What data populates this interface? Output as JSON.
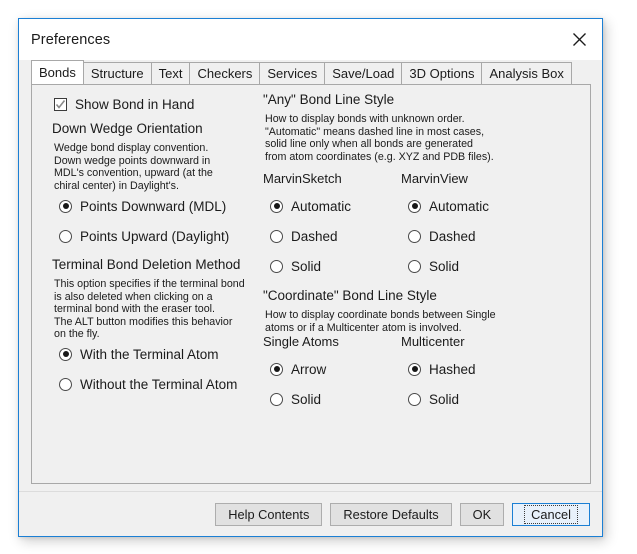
{
  "window": {
    "title": "Preferences",
    "close_icon": "close-icon",
    "accent_color": "#1b7fd4",
    "bg_color": "#f0f0f0"
  },
  "tabs": [
    {
      "label": "Bonds",
      "selected": true
    },
    {
      "label": "Structure",
      "selected": false
    },
    {
      "label": "Text",
      "selected": false
    },
    {
      "label": "Checkers",
      "selected": false
    },
    {
      "label": "Services",
      "selected": false
    },
    {
      "label": "Save/Load",
      "selected": false
    },
    {
      "label": "3D Options",
      "selected": false
    },
    {
      "label": "Analysis Box",
      "selected": false
    }
  ],
  "left": {
    "show_bond_in_hand": {
      "label": "Show Bond in Hand",
      "checked": true,
      "icon": "checkmark-icon"
    },
    "down_wedge": {
      "title": "Down Wedge Orientation",
      "description": "Wedge bond display convention.\nDown wedge points downward in\nMDL's convention, upward (at the\nchiral center) in Daylight's.",
      "options": [
        {
          "label": "Points Downward (MDL)",
          "selected": true
        },
        {
          "label": "Points Upward (Daylight)",
          "selected": false
        }
      ]
    },
    "terminal_bond": {
      "title": "Terminal Bond Deletion Method",
      "description": "This option specifies if the terminal bond\nis also deleted when clicking on a\nterminal bond with the eraser tool.\nThe ALT button modifies this behavior\non the fly.",
      "options": [
        {
          "label": "With the Terminal Atom",
          "selected": true
        },
        {
          "label": "Without the Terminal Atom",
          "selected": false
        }
      ]
    }
  },
  "right": {
    "any_bond": {
      "title": "\"Any\" Bond Line Style",
      "description": "How to display bonds with unknown order.\n\"Automatic\" means dashed line in most cases,\nsolid line only when all bonds are generated\nfrom atom coordinates (e.g. XYZ and PDB files).",
      "columns": [
        {
          "label": "MarvinSketch",
          "options": [
            {
              "label": "Automatic",
              "selected": true
            },
            {
              "label": "Dashed",
              "selected": false
            },
            {
              "label": "Solid",
              "selected": false
            }
          ]
        },
        {
          "label": "MarvinView",
          "options": [
            {
              "label": "Automatic",
              "selected": true
            },
            {
              "label": "Dashed",
              "selected": false
            },
            {
              "label": "Solid",
              "selected": false
            }
          ]
        }
      ]
    },
    "coordinate_bond": {
      "title": "\"Coordinate\" Bond Line Style",
      "description": "How to display coordinate bonds between Single\natoms or if a Multicenter atom is involved.",
      "columns": [
        {
          "label": "Single Atoms",
          "options": [
            {
              "label": "Arrow",
              "selected": true
            },
            {
              "label": "Solid",
              "selected": false
            }
          ]
        },
        {
          "label": "Multicenter",
          "options": [
            {
              "label": "Hashed",
              "selected": true
            },
            {
              "label": "Solid",
              "selected": false
            }
          ]
        }
      ]
    }
  },
  "footer": {
    "buttons": [
      {
        "label": "Help Contents",
        "focused": false
      },
      {
        "label": "Restore Defaults",
        "focused": false
      },
      {
        "label": "OK",
        "focused": false
      },
      {
        "label": "Cancel",
        "focused": true
      }
    ]
  }
}
